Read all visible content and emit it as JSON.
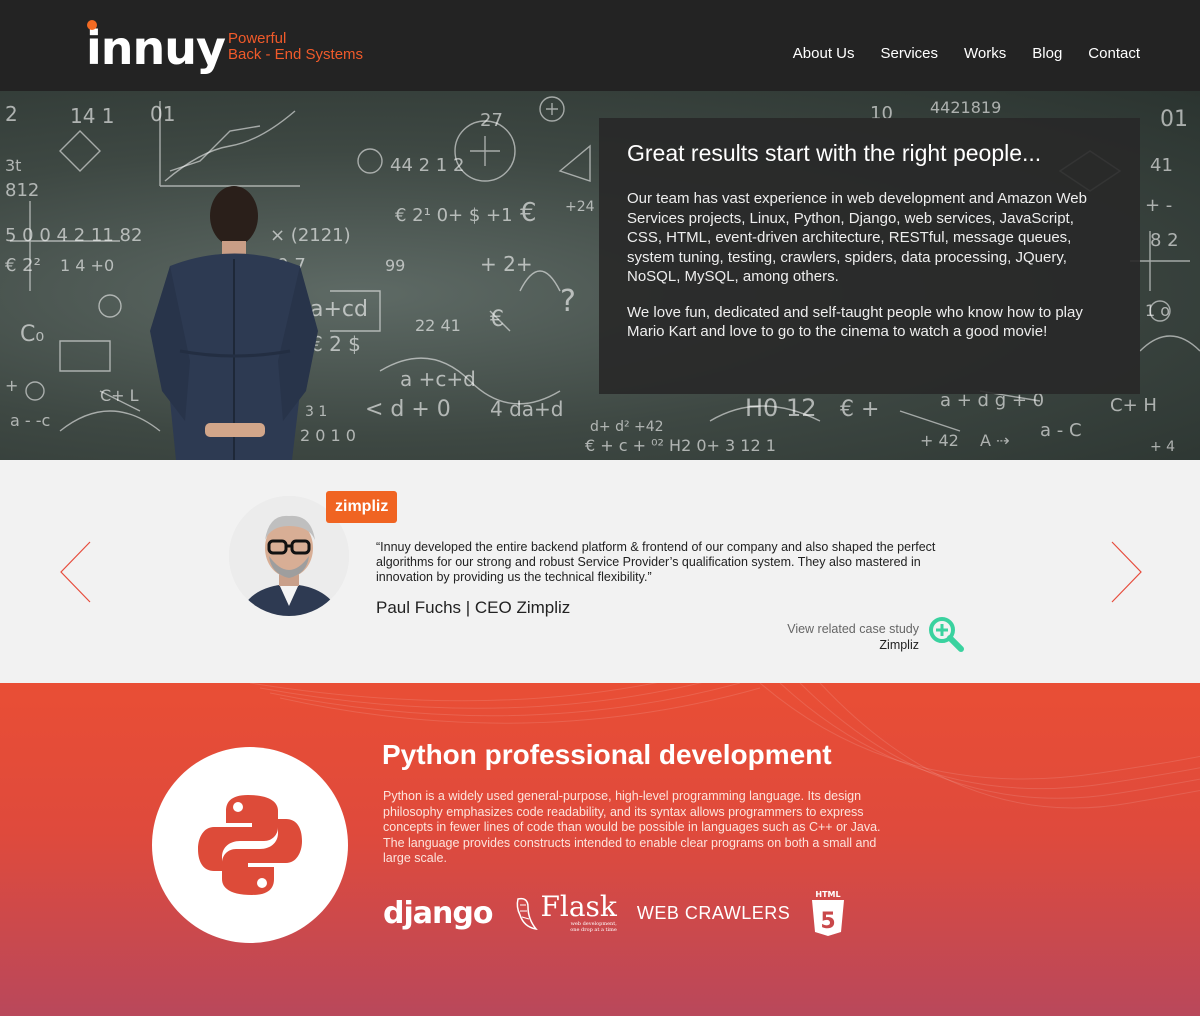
{
  "header": {
    "logo": "innuy",
    "tagline_line1": "Powerful",
    "tagline_line2": "Back - End Systems",
    "nav": [
      "About Us",
      "Services",
      "Works",
      "Blog",
      "Contact"
    ]
  },
  "hero": {
    "title": "Great results start with the right people...",
    "paragraph1": "Our team has vast experience in web development and Amazon Web Services projects, Linux, Python, Django, web services, JavaScript, CSS, HTML, event-driven architecture, RESTful, message queues, system tuning, testing, crawlers, spiders, data processing, JQuery, NoSQL, MySQL, among others.",
    "paragraph2": "We love fun, dedicated and self-taught people who know how to play Mario Kart and love to go to the cinema to watch a good movie!"
  },
  "testimonial": {
    "badge": "zimpliz",
    "quote": "“Innuy developed the entire backend platform & frontend of our company and also shaped the perfect algorithms for our strong and robust Service Provider’s qualification system. They also mastered in innovation by providing us the technical flexibility.”",
    "author": "Paul Fuchs | CEO Zimpliz",
    "case_study_label": "View related case study",
    "case_study_name": "Zimpliz"
  },
  "python": {
    "title": "Python professional development",
    "description": "Python is a widely used general-purpose, high-level programming language. Its design philosophy emphasizes code readability, and its syntax allows programmers to express concepts in fewer lines of code than would be possible in languages such as C++ or Java. The language provides constructs intended to enable clear programs on both a small and large scale.",
    "tech": {
      "django": "django",
      "flask": "Flask",
      "flask_sub1": "web development,",
      "flask_sub2": "one drop at a time",
      "crawlers": "WEB CRAWLERS",
      "html5_label": "HTML",
      "html5_num": "5"
    }
  },
  "colors": {
    "header_bg": "#232323",
    "accent_orange": "#f06422",
    "tagline": "#f05a2a",
    "testimonial_bg": "#f2f2f2",
    "python_top": "#e94e35",
    "python_bottom": "#b9485b",
    "zoom_icon": "#3ad29f"
  },
  "icons": [
    "python-logo-icon",
    "zoom-plus-icon",
    "chevron-left-icon",
    "chevron-right-icon",
    "html5-icon"
  ]
}
